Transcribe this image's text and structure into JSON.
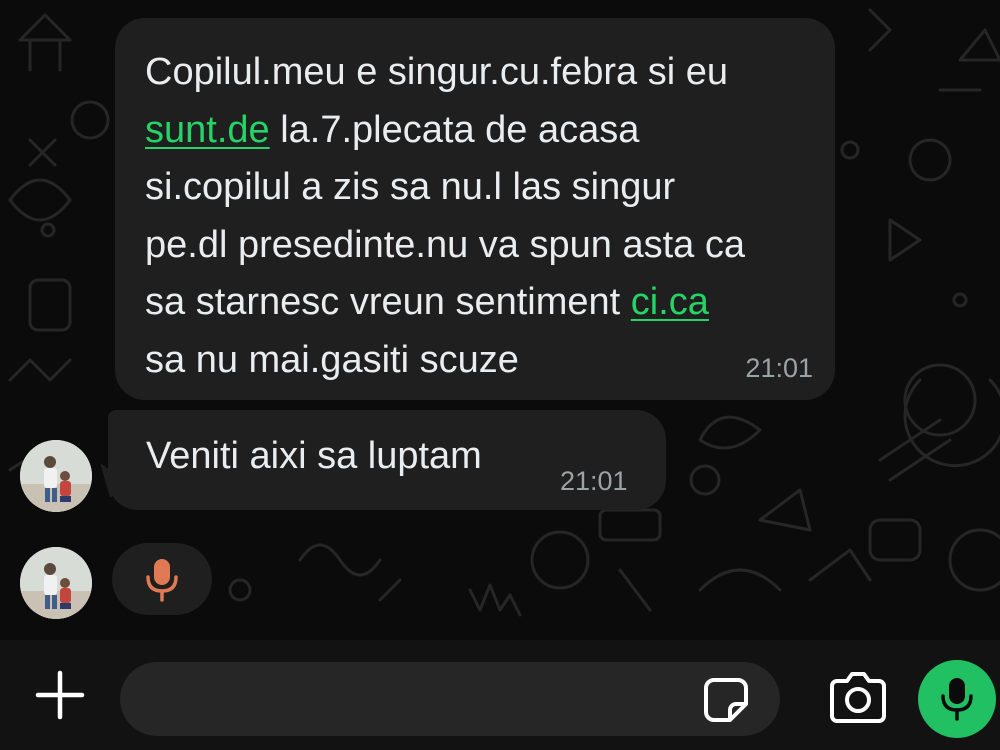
{
  "messages": [
    {
      "lines": [
        {
          "segments": [
            {
              "text": "Copilul.meu e singur.cu.febra si eu",
              "link": false
            }
          ]
        },
        {
          "segments": [
            {
              "text": "sunt.de",
              "link": true
            },
            {
              "text": " la.7.plecata de acasa",
              "link": false
            }
          ]
        },
        {
          "segments": [
            {
              "text": "si.copilul a zis sa nu.l las singur",
              "link": false
            }
          ]
        },
        {
          "segments": [
            {
              "text": "pe.dl presedinte.nu va spun asta ca",
              "link": false
            }
          ]
        },
        {
          "segments": [
            {
              "text": "sa starnesc vreun sentiment ",
              "link": false
            },
            {
              "text": "ci.ca",
              "link": true
            }
          ]
        },
        {
          "segments": [
            {
              "text": "sa nu mai.gasiti scuze",
              "link": false
            }
          ]
        }
      ],
      "time": "21:01"
    },
    {
      "text": "Veniti aixi sa luptam",
      "time": "21:01"
    }
  ],
  "input": {
    "value": "",
    "placeholder": ""
  },
  "colors": {
    "background": "#0b0b0b",
    "bubble": "#1f1f1f",
    "link": "#25d366",
    "accent_mic": "#21c063",
    "recording_mic": "#e07a55",
    "time": "#9ba3a7"
  },
  "icons": {
    "plus": "plus-icon",
    "sticker": "sticker-icon",
    "camera": "camera-icon",
    "mic": "microphone-icon",
    "recording": "microphone-icon"
  }
}
